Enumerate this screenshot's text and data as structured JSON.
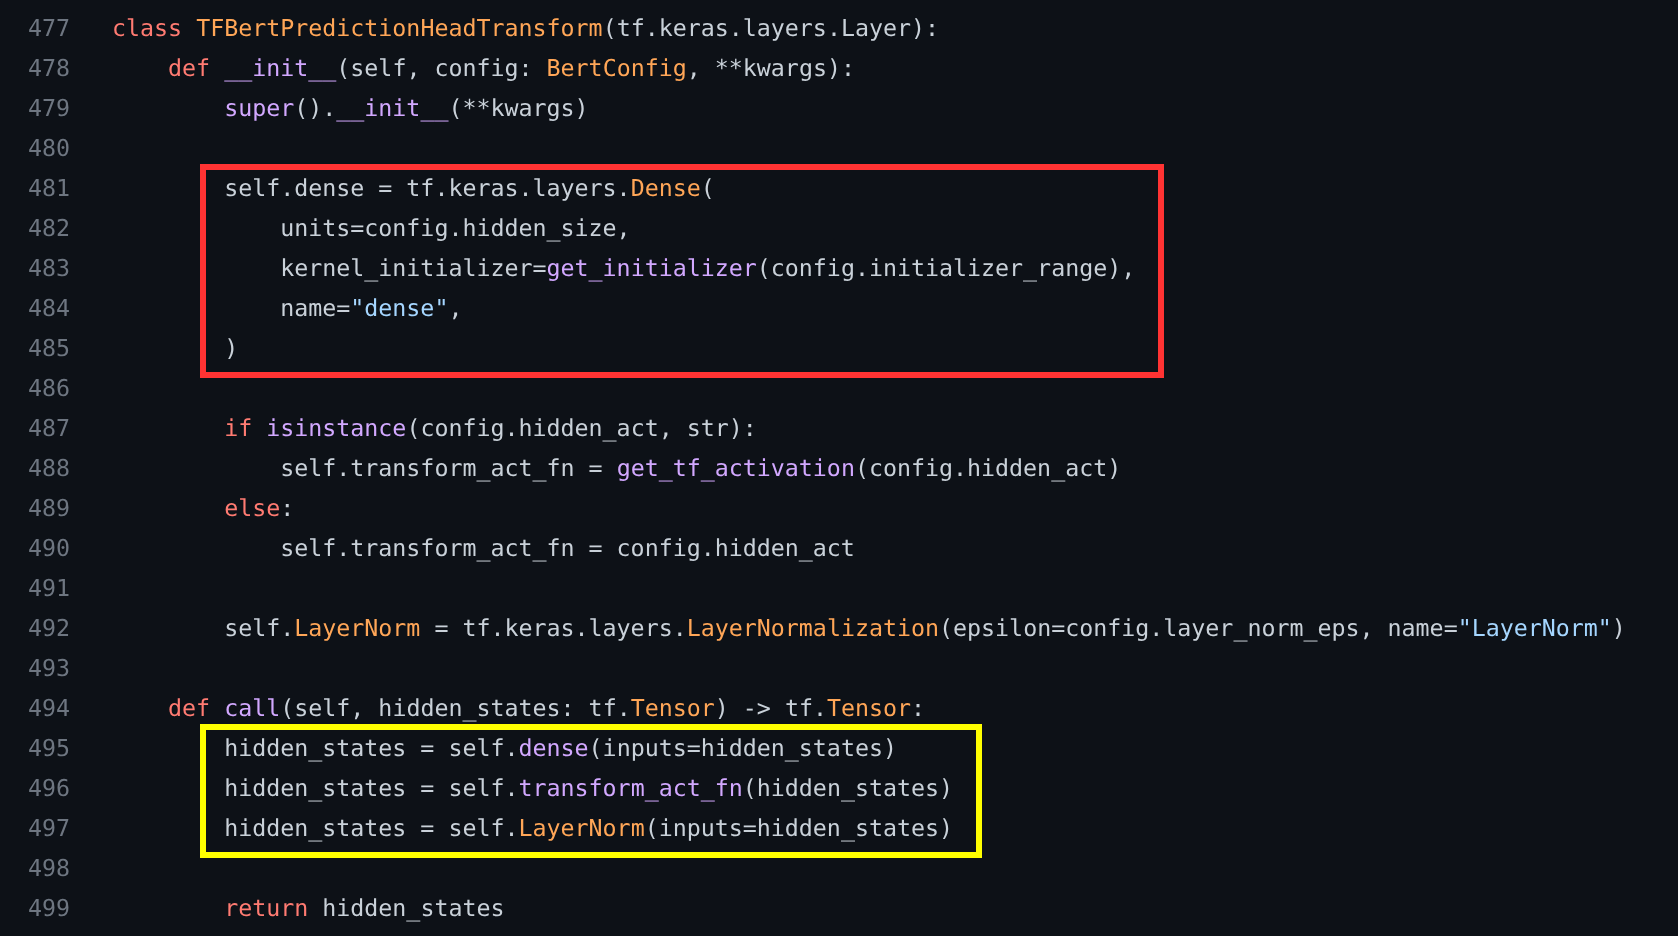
{
  "blocks": [
    {
      "kind": "plain",
      "lines": [
        {
          "number": "477",
          "tokens": [
            {
              "text": "class ",
              "kind": "keyword"
            },
            {
              "text": "TFBertPredictionHeadTransform",
              "kind": "class"
            },
            {
              "text": "(tf.keras.layers.Layer):",
              "kind": "plain"
            }
          ]
        },
        {
          "number": "478",
          "tokens": [
            {
              "text": "    def ",
              "kind": "keyword"
            },
            {
              "text": "__init__",
              "kind": "function"
            },
            {
              "text": "(self, config: ",
              "kind": "plain"
            },
            {
              "text": "BertConfig",
              "kind": "class"
            },
            {
              "text": ", **kwargs):",
              "kind": "plain"
            }
          ]
        },
        {
          "number": "479",
          "tokens": [
            {
              "text": "        super",
              "kind": "function"
            },
            {
              "text": "().",
              "kind": "plain"
            },
            {
              "text": "__init__",
              "kind": "function"
            },
            {
              "text": "(**kwargs)",
              "kind": "plain"
            }
          ]
        },
        {
          "number": "480"
        }
      ]
    },
    {
      "kind": "highlight",
      "color": "#ff3333",
      "lines": [
        {
          "number": "481",
          "tokens": [
            {
              "text": "        self.dense = tf.keras.layers.",
              "kind": "plain"
            },
            {
              "text": "Dense",
              "kind": "class"
            },
            {
              "text": "(",
              "kind": "plain"
            }
          ]
        },
        {
          "number": "482",
          "tokens": [
            {
              "text": "            units=config.hidden_size,",
              "kind": "plain"
            }
          ]
        },
        {
          "number": "483",
          "tokens": [
            {
              "text": "            kernel_initializer=",
              "kind": "plain"
            },
            {
              "text": "get_initializer",
              "kind": "function"
            },
            {
              "text": "(config.initializer_range),",
              "kind": "plain"
            }
          ]
        },
        {
          "number": "484",
          "tokens": [
            {
              "text": "            name=",
              "kind": "plain"
            },
            {
              "text": "\"dense\"",
              "kind": "string"
            },
            {
              "text": ",",
              "kind": "plain"
            }
          ]
        },
        {
          "number": "485",
          "tokens": [
            {
              "text": "        )",
              "kind": "plain"
            }
          ]
        }
      ]
    },
    {
      "kind": "plain",
      "lines": [
        {
          "number": "486"
        },
        {
          "number": "487",
          "tokens": [
            {
              "text": "        if ",
              "kind": "keyword"
            },
            {
              "text": "isinstance",
              "kind": "function"
            },
            {
              "text": "(config.hidden_act, str):",
              "kind": "plain"
            }
          ]
        },
        {
          "number": "488",
          "tokens": [
            {
              "text": "            self.transform_act_fn = ",
              "kind": "plain"
            },
            {
              "text": "get_tf_activation",
              "kind": "function"
            },
            {
              "text": "(config.hidden_act)",
              "kind": "plain"
            }
          ]
        },
        {
          "number": "489",
          "tokens": [
            {
              "text": "        else",
              "kind": "keyword"
            },
            {
              "text": ":",
              "kind": "plain"
            }
          ]
        },
        {
          "number": "490",
          "tokens": [
            {
              "text": "            self.transform_act_fn = config.hidden_act",
              "kind": "plain"
            }
          ]
        },
        {
          "number": "491"
        },
        {
          "number": "492",
          "tokens": [
            {
              "text": "        self.",
              "kind": "plain"
            },
            {
              "text": "LayerNorm",
              "kind": "class"
            },
            {
              "text": " = tf.keras.layers.",
              "kind": "plain"
            },
            {
              "text": "LayerNormalization",
              "kind": "class"
            },
            {
              "text": "(epsilon=config.layer_norm_eps, name=",
              "kind": "plain"
            },
            {
              "text": "\"LayerNorm\"",
              "kind": "string"
            },
            {
              "text": ")",
              "kind": "plain"
            }
          ]
        },
        {
          "number": "493"
        },
        {
          "number": "494",
          "tokens": [
            {
              "text": "    def ",
              "kind": "keyword"
            },
            {
              "text": "call",
              "kind": "function"
            },
            {
              "text": "(self, hidden_states: tf.",
              "kind": "plain"
            },
            {
              "text": "Tensor",
              "kind": "class"
            },
            {
              "text": ") -> tf.",
              "kind": "plain"
            },
            {
              "text": "Tensor",
              "kind": "class"
            },
            {
              "text": ":",
              "kind": "plain"
            }
          ]
        }
      ]
    },
    {
      "kind": "highlight",
      "color": "#ffff00",
      "lines": [
        {
          "number": "495",
          "tokens": [
            {
              "text": "        hidden_states = self.",
              "kind": "plain"
            },
            {
              "text": "dense",
              "kind": "function"
            },
            {
              "text": "(inputs=hidden_states)",
              "kind": "plain"
            }
          ]
        },
        {
          "number": "496",
          "tokens": [
            {
              "text": "        hidden_states = self.",
              "kind": "plain"
            },
            {
              "text": "transform_act_fn",
              "kind": "function"
            },
            {
              "text": "(hidden_states)",
              "kind": "plain"
            }
          ]
        },
        {
          "number": "497",
          "tokens": [
            {
              "text": "        hidden_states = self.",
              "kind": "plain"
            },
            {
              "text": "LayerNorm",
              "kind": "class"
            },
            {
              "text": "(inputs=hidden_states)",
              "kind": "plain"
            }
          ]
        }
      ]
    },
    {
      "kind": "plain",
      "lines": [
        {
          "number": "498"
        },
        {
          "number": "499",
          "tokens": [
            {
              "text": "        return",
              "kind": "keyword"
            },
            {
              "text": " hidden_states",
              "kind": "plain"
            }
          ]
        }
      ]
    }
  ]
}
